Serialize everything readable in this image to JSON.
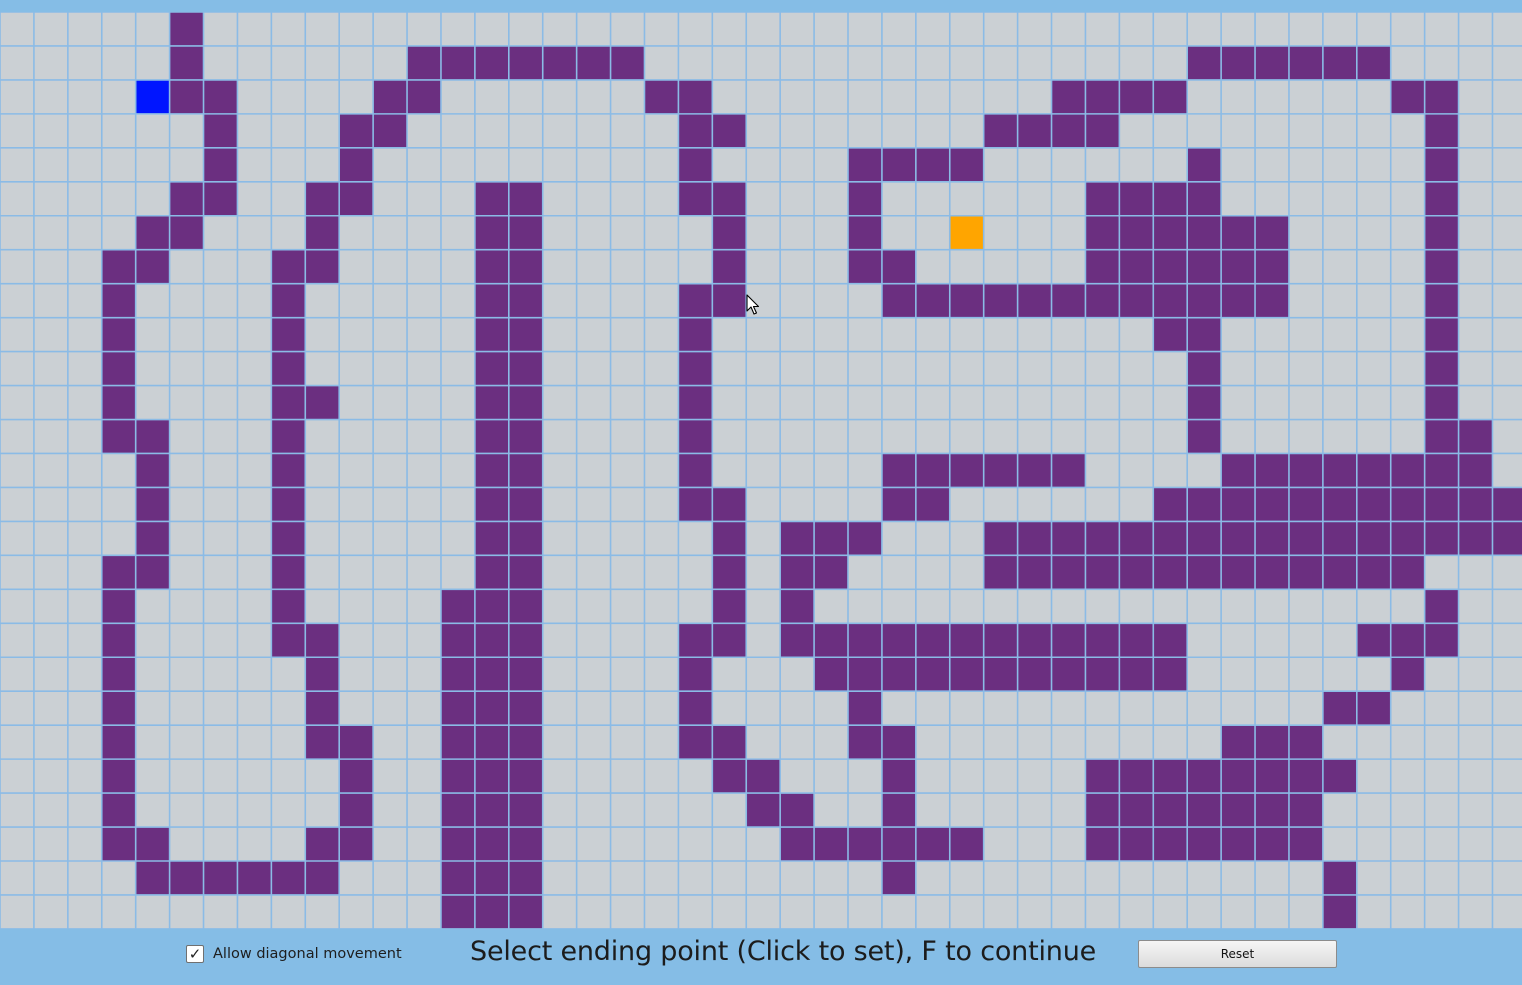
{
  "grid": {
    "rows": 27,
    "cols": 45,
    "colors": {
      "empty": "#cbd0d4",
      "wall": "#6b2f80",
      "start": "#0015ff",
      "end": "#ffa500",
      "grid_line": "#8bbbe6"
    },
    "cell_states": [
      "00000X000000000000000000000000000000000000000",
      "00000X000000XXXXXXX0000000000000000XXXXXX0000",
      "0000SXX0000XX000000XX0000000000XXXX000000XX00",
      "000000X000XX00000000XX0000000XXXX000000000X00",
      "000000X000X000000000X0000XXXX000000X000000X00",
      "00000XX00XX000XX0000XX000X000000XXXX000000X00",
      "0000XX000X0000XX00000X000X00E000XXXXXX0000X00",
      "000XX000XX0000XX00000X000XX00000XXXXXX0000X00",
      "000X0000X00000XX0000XX0000XXXXXXXXXXXX0000X00",
      "000X0000X00000XX0000X0000000000000XX000000X00",
      "000X0000X00000XX0000X00000000000000X000000X00",
      "000X0000XX0000XX0000X00000000000000X000000X00",
      "000XX000X00000XX0000X00000000000000X000000XX0",
      "0000X000X00000XX0000X00000XXXXXX0000XXXXXXXX0",
      "0000X000X00000XX0000XX0000XX000000XXXXXXXXXXX",
      "0000X000X00000XX00000X0XXX000XXXXXXXXXXXXXXXX",
      "000XX000X00000XX00000X0XX0000XXXXXXXXXXXXX000",
      "000X0000X0000XXX00000X0X000000000000000000X00",
      "000X0000XX000XXX0000XX0XXXXXXXXXXXX00000XXX00",
      "000X00000X000XXX0000X000XXXXXXXXXXX000000X000",
      "000X00000X000XXX0000X0000X0000000000000XX0000",
      "000X00000XX00XXX0000XX000XX000000000XXX000000",
      "000X000000X00XXX00000XX000X00000XXXXXXXX00000",
      "000X000000X00XXX000000XX00X00000XXXXXXX000000",
      "000XX0000XX00XXX0000000XXXXXX000XXXXXXX000000",
      "0000XXXXXX000XXX0000000000X000000000000X00000",
      "0000000000000XXX00000000000000000000000X00000"
    ]
  },
  "controls": {
    "diagonal_checkbox_checked": true,
    "diagonal_checkbox_mark": "✓",
    "diagonal_label": "Allow diagonal movement",
    "status_text": "Select ending point (Click to set), F to continue",
    "reset_label": "Reset"
  },
  "icons": {
    "cursor": "mouse-pointer-icon",
    "check": "checkmark-icon"
  }
}
